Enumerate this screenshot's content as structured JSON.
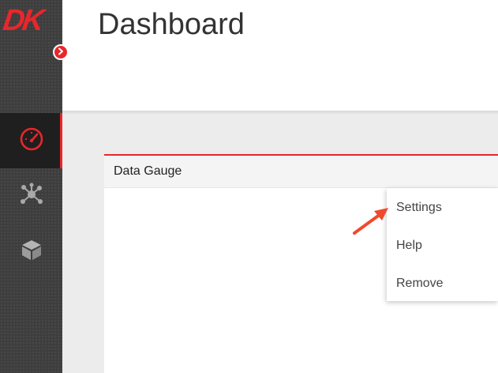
{
  "sidebar": {
    "logo_text": "DK",
    "items": [
      {
        "icon": "gauge-icon",
        "active": true
      },
      {
        "icon": "network-icon",
        "active": false
      },
      {
        "icon": "cube-icon",
        "active": false
      }
    ]
  },
  "header": {
    "title": "Dashboard"
  },
  "widget": {
    "title": "Data Gauge",
    "menu": {
      "items": [
        "Settings",
        "Help",
        "Remove"
      ]
    }
  },
  "colors": {
    "accent": "#e8262b",
    "sidebar_bg": "#3e3e3e",
    "sidebar_active_bg": "#1f1f1f",
    "content_bg": "#ececec"
  }
}
